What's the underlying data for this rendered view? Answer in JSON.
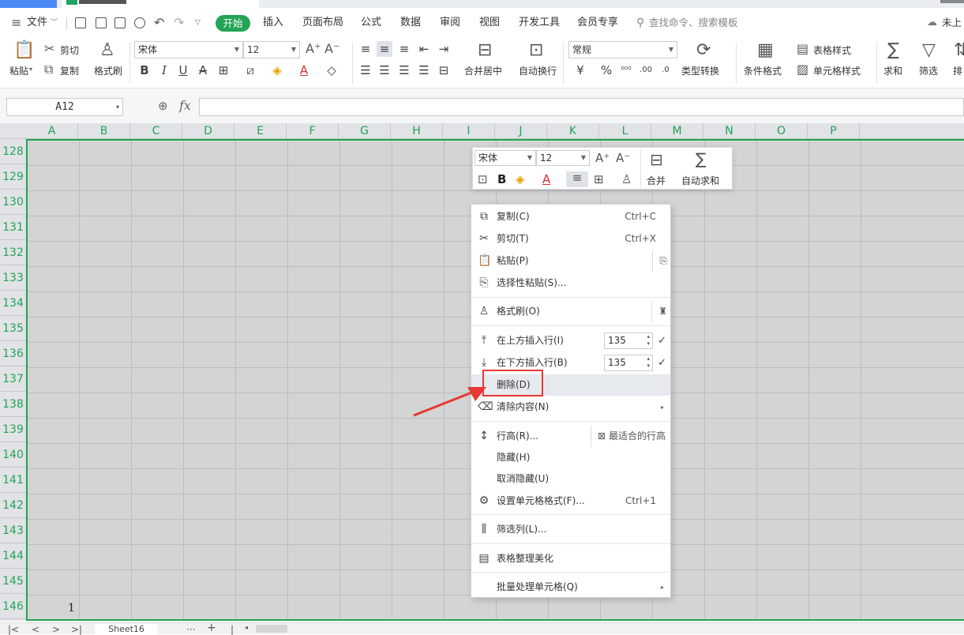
{
  "menubar": {
    "file": "文件",
    "tabs": [
      "开始",
      "插入",
      "页面布局",
      "公式",
      "数据",
      "审阅",
      "视图",
      "开发工具",
      "会员专享"
    ],
    "search_placeholder": "查找命令、搜索模板",
    "cloud": "未上"
  },
  "ribbon": {
    "paste": "粘贴",
    "cut": "剪切",
    "copy": "复制",
    "format_painter": "格式刷",
    "font_name": "宋体",
    "font_size": "12",
    "merge_center": "合并居中",
    "wrap_text": "自动换行",
    "number_format": "常规",
    "type_convert": "类型转换",
    "cond_format": "条件格式",
    "table_style": "表格样式",
    "cell_style": "单元格样式",
    "sum": "求和",
    "filter": "筛选",
    "sort": "排"
  },
  "formula_bar": {
    "name_box": "A12",
    "fx": "fx",
    "value": ""
  },
  "columns": [
    "A",
    "B",
    "C",
    "D",
    "E",
    "F",
    "G",
    "H",
    "I",
    "J",
    "K",
    "L",
    "M",
    "N",
    "O",
    "P"
  ],
  "rows": [
    "128",
    "129",
    "130",
    "131",
    "132",
    "133",
    "134",
    "135",
    "136",
    "137",
    "138",
    "139",
    "140",
    "141",
    "142",
    "143",
    "144",
    "145",
    "146"
  ],
  "cell_values": {
    "A146": "1"
  },
  "mini_toolbar": {
    "font_name": "宋体",
    "font_size": "12",
    "merge": "合并",
    "autosum": "自动求和"
  },
  "context_menu": {
    "items": [
      {
        "label": "复制(C)",
        "shortcut": "Ctrl+C"
      },
      {
        "label": "剪切(T)",
        "shortcut": "Ctrl+X"
      },
      {
        "label": "粘贴(P)",
        "shortcut": ""
      },
      {
        "label": "选择性粘贴(S)...",
        "shortcut": ""
      },
      {
        "label": "格式刷(O)",
        "shortcut": ""
      },
      {
        "label": "在上方插入行(I)",
        "value": "135"
      },
      {
        "label": "在下方插入行(B)",
        "value": "135"
      },
      {
        "label": "删除(D)",
        "shortcut": ""
      },
      {
        "label": "清除内容(N)",
        "shortcut": ""
      },
      {
        "label": "行高(R)...",
        "extra": "最适合的行高"
      },
      {
        "label": "隐藏(H)",
        "shortcut": ""
      },
      {
        "label": "取消隐藏(U)",
        "shortcut": ""
      },
      {
        "label": "设置单元格格式(F)...",
        "shortcut": "Ctrl+1"
      },
      {
        "label": "筛选列(L)...",
        "shortcut": ""
      },
      {
        "label": "表格整理美化",
        "shortcut": ""
      },
      {
        "label": "批量处理单元格(Q)",
        "shortcut": ""
      }
    ]
  },
  "sheet_tabs": {
    "active": "Sheet16"
  },
  "colors": {
    "accent_green": "#22a356",
    "highlight_red": "#e53935"
  }
}
